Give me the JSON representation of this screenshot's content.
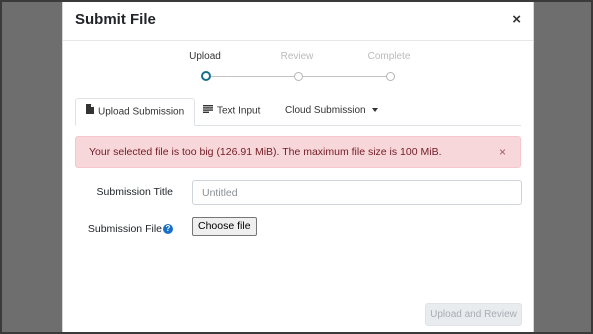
{
  "modal": {
    "title": "Submit File",
    "close_glyph": "×"
  },
  "stepper": {
    "steps": [
      {
        "label": "Upload",
        "active": true
      },
      {
        "label": "Review",
        "active": false
      },
      {
        "label": "Complete",
        "active": false
      }
    ]
  },
  "tabs": [
    {
      "label": "Upload Submission",
      "icon": "file-icon",
      "active": true
    },
    {
      "label": "Text Input",
      "icon": "text-lines-icon",
      "active": false
    },
    {
      "label": "Cloud Submission",
      "icon": "caret-down-icon",
      "active": false
    }
  ],
  "alert": {
    "message": "Your selected file is too big (126.91 MiB). The maximum file size is 100 MiB.",
    "close_glyph": "×"
  },
  "form": {
    "title_label": "Submission Title",
    "title_placeholder": "Untitled",
    "title_value": "",
    "file_label": "Submission File",
    "help_glyph": "?",
    "choose_file_label": "Choose file"
  },
  "footer": {
    "submit_label": "Upload and Review"
  },
  "colors": {
    "primary": "#17718a",
    "alert_bg": "#f8d7da",
    "alert_text": "#721c24",
    "help_icon": "#1a6fc9"
  }
}
